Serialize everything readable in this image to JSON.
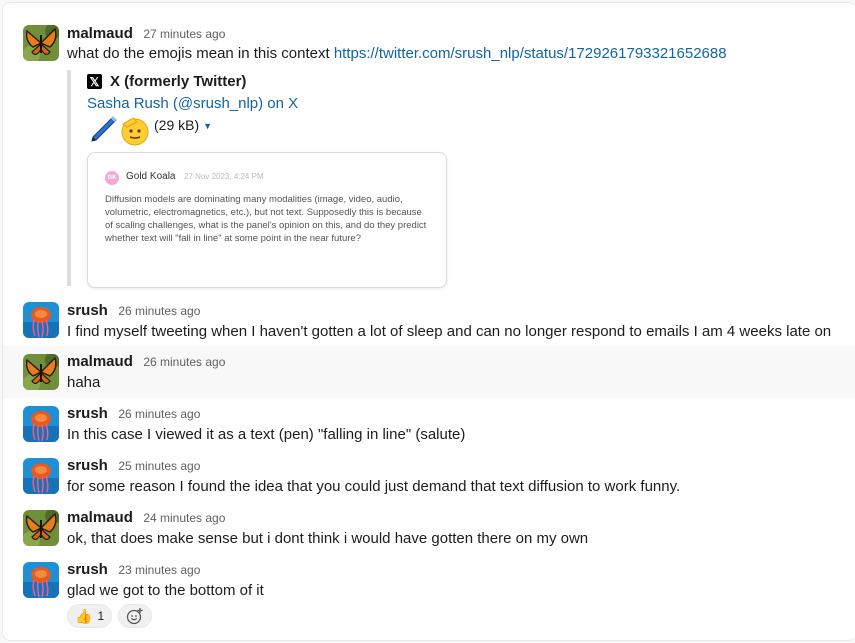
{
  "users": {
    "malmaud": {
      "name": "malmaud",
      "avatar": "butterfly-avatar"
    },
    "srush": {
      "name": "srush",
      "avatar": "jellyfish-avatar"
    }
  },
  "messages": [
    {
      "author": "malmaud",
      "time": "27 minutes ago",
      "text": "what do the emojis mean in this context ",
      "link": "https://twitter.com/srush_nlp/status/1729261793321652688",
      "unfurl": {
        "source_logo": "x-logo-icon",
        "source": "X (formerly Twitter)",
        "title": "Sasha Rush (@srush_nlp) on X",
        "emojis": [
          "pen-icon",
          "saluting-face-icon"
        ],
        "size": "(29 kB)",
        "card": {
          "initials": "GK",
          "name": "Gold Koala",
          "date": "27 Nov 2023, 4:24 PM",
          "text": "Diffusion models are dominating many modalities (image, video, audio, volumetric, electromagnetics, etc.), but not text. Supposedly this is because of scaling challenges, what is the panel's opinion on this, and do they predict whether text will \"fall in line\" at some point in the near future?"
        }
      }
    },
    {
      "author": "srush",
      "time": "26 minutes ago",
      "text": "I find myself tweeting when I haven't gotten a lot of sleep and can no longer respond to emails I am 4 weeks late on"
    },
    {
      "author": "malmaud",
      "time": "26 minutes ago",
      "text": "haha"
    },
    {
      "author": "srush",
      "time": "26 minutes ago",
      "text": "In this case I viewed it as a text (pen) \"falling in line\" (salute)"
    },
    {
      "author": "srush",
      "time": "25 minutes ago",
      "text": "for some reason I found the idea that you could just demand that text diffusion to work funny."
    },
    {
      "author": "malmaud",
      "time": "24 minutes ago",
      "text": "ok, that does make sense but i dont think i would have gotten there on my own"
    },
    {
      "author": "srush",
      "time": "23 minutes ago",
      "text": "glad we got to the bottom of it",
      "reactions": [
        {
          "emoji": "thumbs-up-icon",
          "glyph": "👍",
          "count": "1"
        }
      ],
      "add_reaction": "add-reaction-icon"
    }
  ],
  "colors": {
    "link": "#1264a3",
    "hover_bg": "#f8f8f8",
    "quote_bar": "#dddddd"
  }
}
